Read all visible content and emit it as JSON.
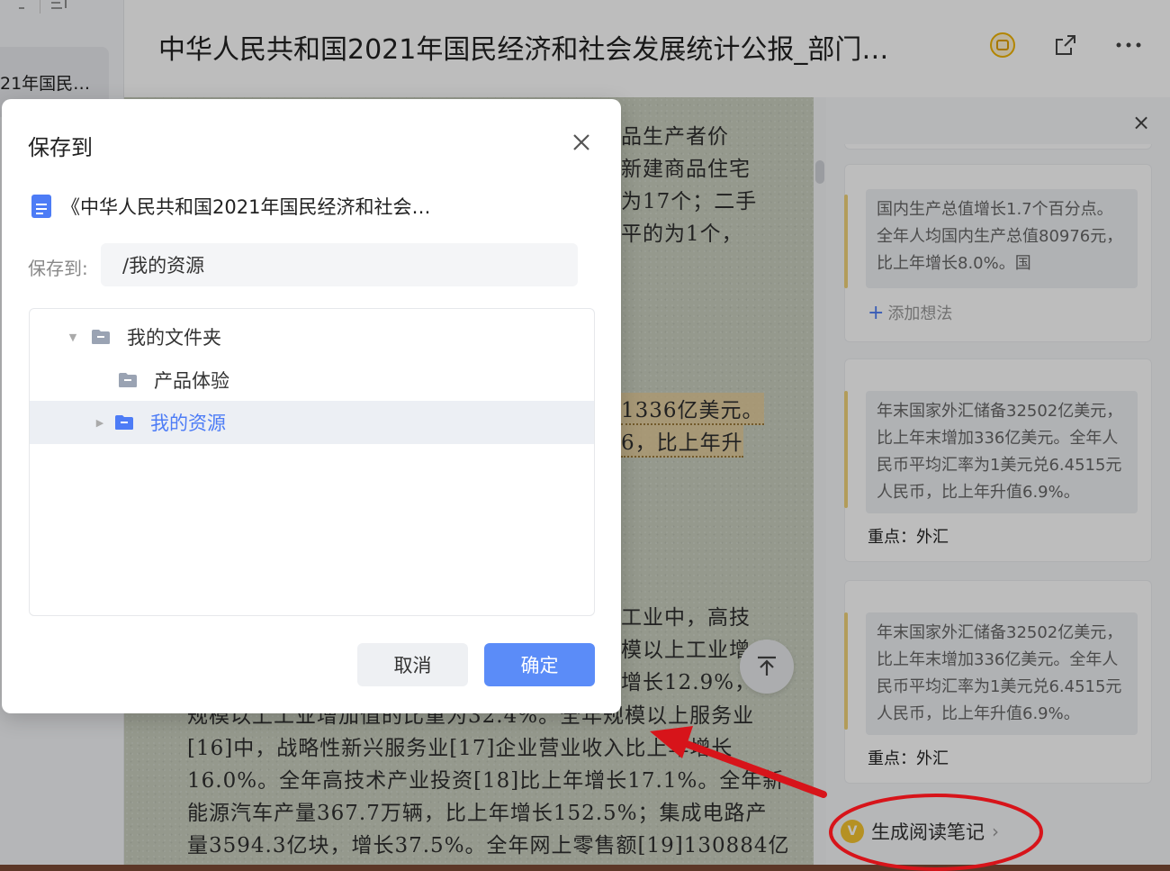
{
  "app": {
    "doc_title": "中华人民共和国2021年国民经济和社会发展统计公报_部门政…",
    "sidebar_doc": "21年国民…"
  },
  "paper": {
    "lines": [
      "品生产者价",
      "新建商品住宅",
      "为17个；二手",
      "平的为1个，",
      "1336亿美元。",
      "6，比上年升",
      "工业中，高技",
      "模以上工业增",
      "增长12.9%，占",
      "规模以上工业增加值的比重为32.4%。全年规模以上服务业",
      "[16]中，战略性新兴服务业[17]企业营业收入比上年增长",
      "16.0%。全年高技术产业投资[18]比上年增长17.1%。全年新",
      "能源汽车产量367.7万辆，比上年增长152.5%；集成电路产",
      "量3594.3亿块，增长37.5%。全年网上零售额[19]130884亿"
    ]
  },
  "notes": {
    "cards": [
      {
        "text": "国内生产总值增长1.7个百分点。全年人均国内生产总值80976元，比上年增长8.0%。国",
        "footer": "添加想法"
      },
      {
        "text": "年末国家外汇储备32502亿美元，比上年末增加336亿美元。全年人民币平均汇率为1美元兑6.4515元人民币，比上年升值6.9%。",
        "footer": "重点：外汇"
      },
      {
        "text": "年末国家外汇储备32502亿美元，比上年末增加336亿美元。全年人民币平均汇率为1美元兑6.4515元人民币，比上年升值6.9%。",
        "footer": "重点：外汇"
      }
    ],
    "generate_label": "生成阅读笔记"
  },
  "dialog": {
    "title": "保存到",
    "doc_name": "《中华人民共和国2021年国民经济和社会…",
    "path_label": "保存到:",
    "path_value": "/我的资源",
    "tree": [
      {
        "label": "我的文件夹",
        "expanded": true
      },
      {
        "label": "产品体验"
      },
      {
        "label": "我的资源",
        "selected": true
      }
    ],
    "cancel_label": "取消",
    "ok_label": "确定"
  },
  "colors": {
    "accent": "#5b8cf8",
    "selected_text": "#4d7cf6",
    "annotation_red": "#d7141a",
    "quote_bar": "#f0d37a"
  }
}
